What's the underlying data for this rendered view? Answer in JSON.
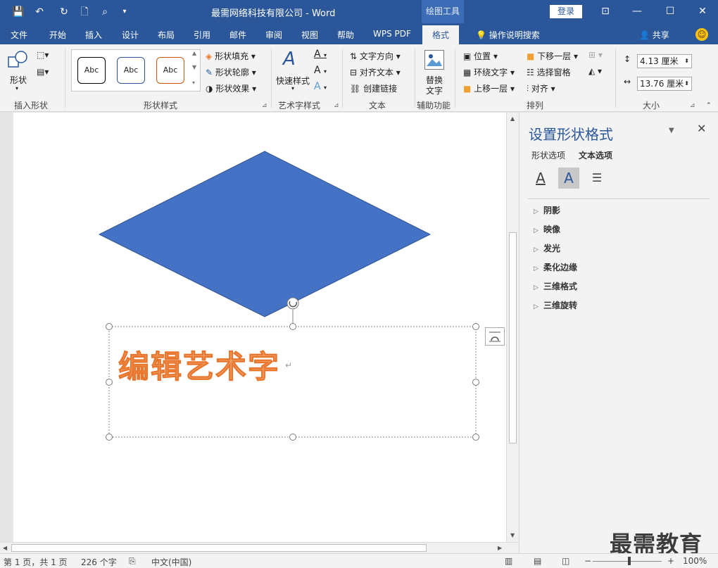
{
  "titlebar": {
    "doc_title": "最需网络科技有限公司  -  Word",
    "drawing_tools": "绘图工具",
    "login": "登录",
    "qat": {
      "save": "💾",
      "undo": "↶",
      "redo": "↻",
      "new": "🗋",
      "touch": "⌕",
      "customize": "▾"
    },
    "win": {
      "ribbon_opt": "⊡",
      "min": "—",
      "max": "☐",
      "close": "✕"
    }
  },
  "tabs": [
    {
      "label": "文件"
    },
    {
      "label": "开始"
    },
    {
      "label": "插入"
    },
    {
      "label": "设计"
    },
    {
      "label": "布局"
    },
    {
      "label": "引用"
    },
    {
      "label": "邮件"
    },
    {
      "label": "审阅"
    },
    {
      "label": "视图"
    },
    {
      "label": "帮助"
    },
    {
      "label": "WPS PDF"
    },
    {
      "label": "格式"
    }
  ],
  "tell_me": "操作说明搜索",
  "share": "共享",
  "ribbon": {
    "insert_shapes": {
      "label": "插入形状",
      "shapes": "形状"
    },
    "shape_styles": {
      "label": "形状样式",
      "abc1": "Abc",
      "abc2": "Abc",
      "abc3": "Abc",
      "fill": "形状填充",
      "outline": "形状轮廓",
      "effects": "形状效果"
    },
    "wordart": {
      "label": "艺术字样式",
      "quick": "快速样式"
    },
    "text": {
      "label": "文本",
      "direction": "文字方向",
      "align": "对齐文本",
      "link": "创建链接"
    },
    "accessibility": {
      "label": "辅助功能",
      "alt_line1": "替换",
      "alt_line2": "文字"
    },
    "arrange": {
      "label": "排列",
      "position": "位置",
      "wrap": "环绕文字",
      "forward": "上移一层",
      "backward": "下移一层",
      "pane": "选择窗格",
      "align": "对齐"
    },
    "size": {
      "label": "大小",
      "height": "4.13 厘米",
      "width": "13.76 厘米"
    }
  },
  "document": {
    "wordart_text": "编辑艺术字",
    "para_mark": "↵",
    "colors": {
      "diamond": "#4472c4",
      "wordart_fill": "#f4a673",
      "wordart_outline": "#e8762d"
    }
  },
  "panel": {
    "title": "设置形状格式",
    "tab_shape": "形状选项",
    "tab_text": "文本选项",
    "sections": [
      "阴影",
      "映像",
      "发光",
      "柔化边缘",
      "三维格式",
      "三维旋转"
    ]
  },
  "watermark": "最需教育",
  "status": {
    "page": "第 1 页，共 1 页",
    "words": "226 个字",
    "lang": "中文(中国)",
    "zoom": "100%"
  }
}
